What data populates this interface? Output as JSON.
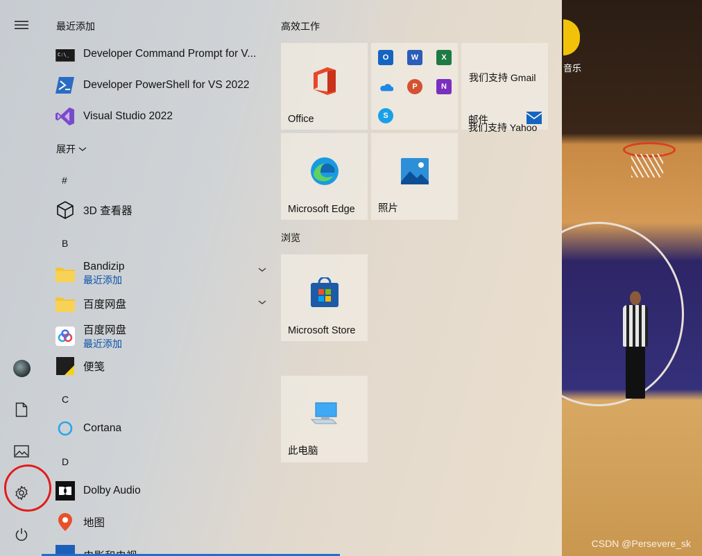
{
  "menu": {
    "recent_header": "最近添加",
    "recent": [
      {
        "name": "Developer Command Prompt for V...",
        "icon": "command-prompt-icon"
      },
      {
        "name": "Developer PowerShell for VS 2022",
        "icon": "powershell-icon"
      },
      {
        "name": "Visual Studio 2022",
        "icon": "visual-studio-icon"
      }
    ],
    "expand_label": "展开",
    "letters": {
      "hash": "#",
      "b": "B",
      "c": "C",
      "d": "D"
    },
    "apps": {
      "viewer3d": "3D 查看器",
      "bandizip": "Bandizip",
      "bandizip_sub": "最近添加",
      "baidu_folder": "百度网盘",
      "baidu_app": "百度网盘",
      "baidu_app_sub": "最近添加",
      "sticky": "便笺",
      "cortana": "Cortana",
      "dolby": "Dolby Audio",
      "maps": "地图",
      "movies": "电影和电视"
    }
  },
  "tiles": {
    "group1": "高效工作",
    "group2": "浏览",
    "office": "Office",
    "gmail": "我们支持 Gmail",
    "mail": "邮件",
    "yahoo": "我们支持 Yahoo",
    "edge": "Microsoft Edge",
    "photos": "照片",
    "store": "Microsoft Store",
    "pc": "此电脑",
    "mini_apps": [
      "O",
      "W",
      "X",
      "",
      "P",
      "N",
      "S"
    ]
  },
  "desktop": {
    "label": "音乐",
    "watermark": "CSDN @Persevere_sk"
  },
  "colors": {
    "accent": "#1f6fd1",
    "annotation": "#e01c1c",
    "link_blue": "#0a4fa8"
  }
}
